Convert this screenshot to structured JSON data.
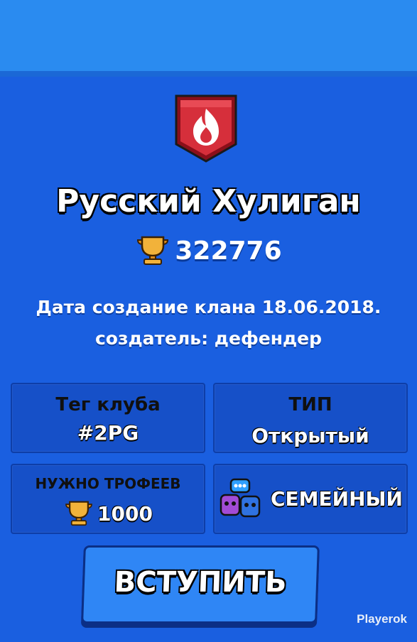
{
  "club": {
    "name": "Русский Хулиган",
    "trophies": "322776",
    "description_line1": "Дата создание клана 18.06.2018.",
    "description_line2": "создатель: дефендер",
    "badge_icon": "flame-shield-icon"
  },
  "cards": {
    "tag": {
      "label": "Тег клуба",
      "value": "#2PG"
    },
    "type": {
      "label": "ТИП",
      "value": "Открытый"
    },
    "required": {
      "label": "НУЖНО ТРОФЕЕВ",
      "value": "1000",
      "icon": "trophy-icon"
    },
    "activity": {
      "value": "СЕМЕЙНЫЙ",
      "icon": "family-chat-icon"
    }
  },
  "actions": {
    "join_label": "ВСТУПИТЬ"
  },
  "watermark": "Playerok",
  "colors": {
    "background": "#1a5fe0",
    "card": "#1650c8",
    "button": "#2f86f5",
    "badge": "#d62f3b"
  }
}
